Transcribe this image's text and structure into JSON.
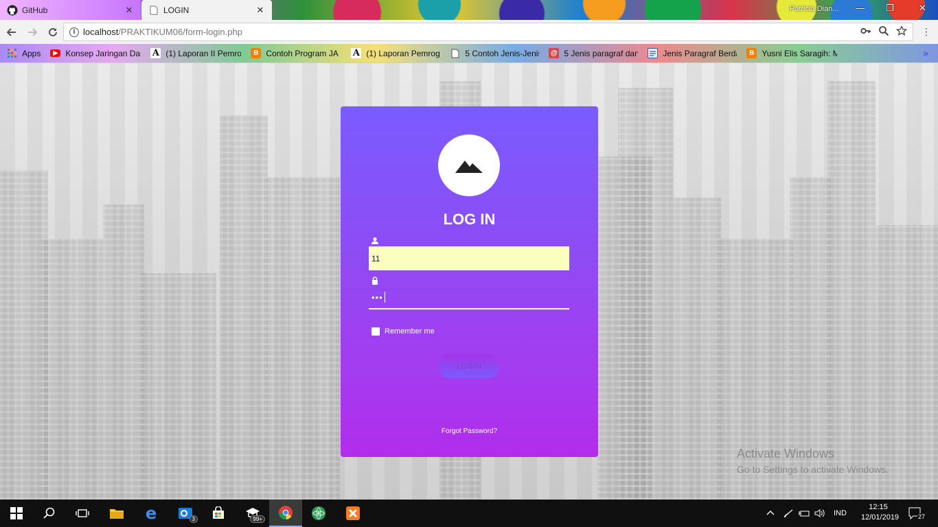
{
  "browser": {
    "tabs": [
      {
        "title": "GitHub",
        "icon": "github-icon",
        "close": "✕"
      },
      {
        "title": "LOGIN",
        "icon": "page-icon",
        "close": "✕"
      }
    ],
    "profile_name": "Patricia Dian...",
    "url_host": "localhost",
    "url_path": "/PRAKTIKUM06/form-login.php",
    "bookmarks": [
      {
        "label": "Apps",
        "icon": "apps-grid-icon",
        "color": "#e14b3b"
      },
      {
        "label": "Konsep Jaringan Das",
        "icon": "youtube-icon",
        "color": "#ff0000"
      },
      {
        "label": "(1) Laporan II Pemro",
        "icon": "academia-icon",
        "color": "#222222"
      },
      {
        "label": "Contoh Program JA",
        "icon": "blogger-icon",
        "color": "#f57d00"
      },
      {
        "label": "(1) Laporan Pemrog",
        "icon": "academia-icon",
        "color": "#222222"
      },
      {
        "label": "5 Contoh Jenis-Jenis",
        "icon": "document-icon",
        "color": "#555555"
      },
      {
        "label": "5 Jenis paragraf dan",
        "icon": "at-sign-icon",
        "color": "#d94848"
      },
      {
        "label": "Jenis Paragraf Berda",
        "icon": "site-icon",
        "color": "#3a5fa8"
      },
      {
        "label": "Yusni Elis Saragih: M",
        "icon": "blogger-icon",
        "color": "#f57d00"
      }
    ],
    "more": "»"
  },
  "login": {
    "title": "LOG IN",
    "username_value": "11",
    "password_mask": "•••",
    "remember_label": "Remember me",
    "login_button": "LOGIN",
    "forgot_link": "Forgot Password?"
  },
  "watermark": {
    "title": "Activate Windows",
    "subtitle": "Go to Settings to activate Windows."
  },
  "taskbar": {
    "language": "IND",
    "time": "12:15",
    "date": "12/01/2019",
    "notification_count": "27",
    "mail_badge": "3",
    "store_badge": "99+"
  },
  "colors": {
    "card_top": "#7a5cff",
    "card_bottom": "#b12deb",
    "autofill_bg": "#faffbd"
  }
}
